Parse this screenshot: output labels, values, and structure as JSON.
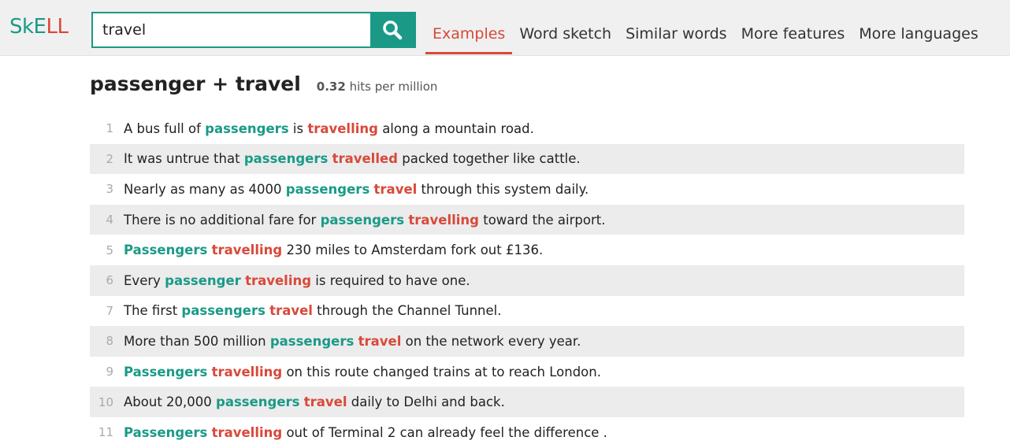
{
  "logo": {
    "sk": "SkE",
    "ll": "LL"
  },
  "search": {
    "value": "travel",
    "button_icon": "search-icon"
  },
  "nav": [
    {
      "label": "Examples",
      "active": true
    },
    {
      "label": "Word sketch",
      "active": false
    },
    {
      "label": "Similar words",
      "active": false
    },
    {
      "label": "More features",
      "active": false
    },
    {
      "label": "More languages",
      "active": false
    }
  ],
  "result": {
    "query": "passenger + travel",
    "hits": "0.32",
    "hits_label": "hits per million"
  },
  "colors": {
    "accent": "#1a9a86",
    "collocate": "#d8493a"
  },
  "examples": [
    {
      "num": "1",
      "parts": [
        [
          "t",
          "A bus full of "
        ],
        [
          "k",
          "passengers"
        ],
        [
          "t",
          " is "
        ],
        [
          "c",
          "travelling"
        ],
        [
          "t",
          " along a mountain road."
        ]
      ]
    },
    {
      "num": "2",
      "parts": [
        [
          "t",
          "It was untrue that "
        ],
        [
          "k",
          "passengers"
        ],
        [
          "t",
          " "
        ],
        [
          "c",
          "travelled"
        ],
        [
          "t",
          " packed together like cattle."
        ]
      ]
    },
    {
      "num": "3",
      "parts": [
        [
          "t",
          "Nearly as many as 4000 "
        ],
        [
          "k",
          "passengers"
        ],
        [
          "t",
          " "
        ],
        [
          "c",
          "travel"
        ],
        [
          "t",
          " through this system daily."
        ]
      ]
    },
    {
      "num": "4",
      "parts": [
        [
          "t",
          "There is no additional fare for "
        ],
        [
          "k",
          "passengers"
        ],
        [
          "t",
          " "
        ],
        [
          "c",
          "travelling"
        ],
        [
          "t",
          " toward the airport."
        ]
      ]
    },
    {
      "num": "5",
      "parts": [
        [
          "k",
          "Passengers"
        ],
        [
          "t",
          " "
        ],
        [
          "c",
          "travelling"
        ],
        [
          "t",
          " 230 miles to Amsterdam fork out £136."
        ]
      ]
    },
    {
      "num": "6",
      "parts": [
        [
          "t",
          "Every "
        ],
        [
          "k",
          "passenger"
        ],
        [
          "t",
          " "
        ],
        [
          "c",
          "traveling"
        ],
        [
          "t",
          " is required to have one."
        ]
      ]
    },
    {
      "num": "7",
      "parts": [
        [
          "t",
          "The first "
        ],
        [
          "k",
          "passengers"
        ],
        [
          "t",
          " "
        ],
        [
          "c",
          "travel"
        ],
        [
          "t",
          " through the Channel Tunnel."
        ]
      ]
    },
    {
      "num": "8",
      "parts": [
        [
          "t",
          "More than 500 million "
        ],
        [
          "k",
          "passengers"
        ],
        [
          "t",
          " "
        ],
        [
          "c",
          "travel"
        ],
        [
          "t",
          " on the network every year."
        ]
      ]
    },
    {
      "num": "9",
      "parts": [
        [
          "k",
          "Passengers"
        ],
        [
          "t",
          " "
        ],
        [
          "c",
          "travelling"
        ],
        [
          "t",
          " on this route changed trains at to reach London."
        ]
      ]
    },
    {
      "num": "10",
      "parts": [
        [
          "t",
          "About 20,000 "
        ],
        [
          "k",
          "passengers"
        ],
        [
          "t",
          " "
        ],
        [
          "c",
          "travel"
        ],
        [
          "t",
          " daily to Delhi and back."
        ]
      ]
    },
    {
      "num": "11",
      "parts": [
        [
          "k",
          "Passengers"
        ],
        [
          "t",
          " "
        ],
        [
          "c",
          "travelling"
        ],
        [
          "t",
          " out of Terminal 2 can already feel the difference ."
        ]
      ]
    }
  ]
}
